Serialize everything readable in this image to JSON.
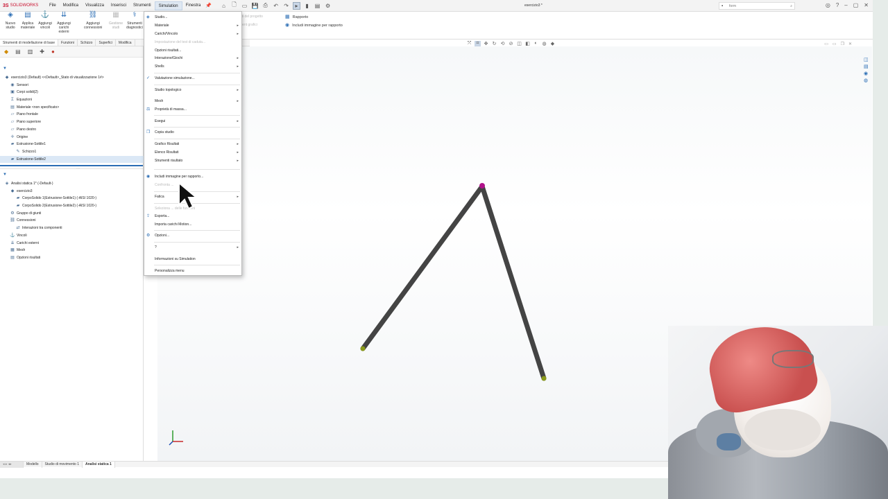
{
  "app": {
    "brand_prefix": "3S",
    "brand_name": "SOLIDWORKS",
    "document_title": "esercizio3 *",
    "search_placeholder": "form"
  },
  "menubar": [
    "File",
    "Modifica",
    "Visualizza",
    "Inserisci",
    "Strumenti",
    "Simulation",
    "Finestra"
  ],
  "commands": [
    {
      "label": "Nuovo studio",
      "icon": "study-icon"
    },
    {
      "label": "Applica materiale",
      "icon": "material-icon"
    },
    {
      "label": "Aggiungi vincoli",
      "icon": "fixture-icon"
    },
    {
      "label": "Aggiungi carichi esterni",
      "icon": "load-icon"
    },
    {
      "label": "Aggiungi connessioni",
      "icon": "connection-icon"
    },
    {
      "label": "Gestione studi",
      "icon": "manage-icon"
    },
    {
      "label": "Strumenti diagnostici",
      "icon": "diagnostic-icon"
    }
  ],
  "cmd_right": {
    "rapporto": "Rapporto",
    "include_image": "Includi immagine per rapporto",
    "ghost_1": "isti del progetto",
    "ghost_2": "ment grafici"
  },
  "tabs": [
    "Strumenti di modellazione di base",
    "Funzioni",
    "Schizzo",
    "Superfici",
    "Modifica"
  ],
  "feature_tree": [
    {
      "label": "esercizio3 (Default) <<Default>_Stato di visualizzazione 1#>",
      "icon": "part-icon",
      "level": 0
    },
    {
      "label": "Sensori",
      "icon": "sensor-icon",
      "level": 1
    },
    {
      "label": "Corpi solidi(2)",
      "icon": "solid-bodies-icon",
      "level": 1
    },
    {
      "label": "Equazioni",
      "icon": "equation-icon",
      "level": 1
    },
    {
      "label": "Materiale <non specificato>",
      "icon": "material-icon",
      "level": 1
    },
    {
      "label": "Piano frontale",
      "icon": "plane-icon",
      "level": 1
    },
    {
      "label": "Piano superiore",
      "icon": "plane-icon",
      "level": 1
    },
    {
      "label": "Piano destro",
      "icon": "plane-icon",
      "level": 1
    },
    {
      "label": "Origine",
      "icon": "origin-icon",
      "level": 1
    },
    {
      "label": "Estrusione-Sottile1",
      "icon": "extrude-icon",
      "level": 1
    },
    {
      "label": "Schizzo1",
      "icon": "sketch-icon",
      "level": 2
    },
    {
      "label": "Estrusione-Sottile2",
      "icon": "extrude-icon",
      "level": 1
    }
  ],
  "sim_tree": [
    {
      "label": "Analisi statica 1* (-Default-)",
      "icon": "analysis-icon",
      "level": 0
    },
    {
      "label": "esercizio3",
      "icon": "part-icon",
      "level": 1
    },
    {
      "label": "CorpoSolido 1(Estrusione-Sottile1) (-AISI 1020-)",
      "icon": "body-icon",
      "level": 2
    },
    {
      "label": "CorpoSolido 2(Estrusione-Sottile2) (-AISI 1020-)",
      "icon": "body-icon",
      "level": 2
    },
    {
      "label": "Gruppo di giunti",
      "icon": "joint-group-icon",
      "level": 1
    },
    {
      "label": "Connessioni",
      "icon": "connections-icon",
      "level": 1
    },
    {
      "label": "Interazioni tra componenti",
      "icon": "interaction-icon",
      "level": 2
    },
    {
      "label": "Vincoli",
      "icon": "fixture-icon",
      "level": 1
    },
    {
      "label": "Carichi esterni",
      "icon": "load-icon",
      "level": 1
    },
    {
      "label": "Mesh",
      "icon": "mesh-icon",
      "level": 1
    },
    {
      "label": "Opzioni risultati",
      "icon": "results-icon",
      "level": 1
    }
  ],
  "simulation_menu": [
    {
      "label": "Studio...",
      "icon": "study-icon",
      "arrow": false,
      "disabled": false
    },
    {
      "label": "Materiale",
      "arrow": true,
      "disabled": false
    },
    {
      "label": "Carichi/Vincolo",
      "arrow": true,
      "disabled": false
    },
    {
      "label": "Impostazione del test di caduta...",
      "arrow": false,
      "disabled": true
    },
    {
      "label": "Opzioni risultati...",
      "arrow": false,
      "disabled": false
    },
    {
      "label": "Interazione/Giochi",
      "arrow": true,
      "disabled": false
    },
    {
      "label": "Shells",
      "arrow": true,
      "disabled": false
    },
    {
      "label": "Valutazione simulazione...",
      "icon": "evaluate-icon",
      "arrow": false,
      "disabled": false
    },
    {
      "label": "Studio topologico",
      "arrow": true,
      "disabled": false
    },
    {
      "label": "Mesh",
      "arrow": true,
      "disabled": false
    },
    {
      "label": "Proprietà di massa...",
      "icon": "mass-icon",
      "arrow": false,
      "disabled": false
    },
    {
      "label": "Esegui",
      "arrow": true,
      "disabled": false
    },
    {
      "label": "Copia studio",
      "icon": "copy-icon",
      "arrow": false,
      "disabled": false
    },
    {
      "label": "Grafico Risultati",
      "arrow": true,
      "disabled": false
    },
    {
      "label": "Elenco Risultati",
      "arrow": true,
      "disabled": false
    },
    {
      "label": "Strumenti risultato",
      "arrow": true,
      "disabled": false
    },
    {
      "label": "Includi immagine per rapporto...",
      "icon": "image-icon",
      "arrow": false,
      "disabled": false
    },
    {
      "label": "Confronta ...",
      "arrow": false,
      "disabled": true
    },
    {
      "label": "Fatica",
      "arrow": true,
      "disabled": false
    },
    {
      "label": "Seleziona ... delle funzioni",
      "arrow": false,
      "disabled": true
    },
    {
      "label": "Esporta...",
      "icon": "export-icon",
      "arrow": false,
      "disabled": false
    },
    {
      "label": "Importa carichi Motion...",
      "arrow": false,
      "disabled": false
    },
    {
      "label": "Opzioni...",
      "icon": "options-icon",
      "arrow": false,
      "disabled": false
    },
    {
      "label": "?",
      "arrow": true,
      "disabled": false
    },
    {
      "label": "Informazioni su Simulation",
      "arrow": false,
      "disabled": false
    },
    {
      "label": "Personalizza menu",
      "arrow": false,
      "disabled": false
    }
  ],
  "bottom_tabs": [
    "Modello",
    "Studio di movimento 1",
    "Analisi statica 1"
  ],
  "colors": {
    "accent": "#2a6db4",
    "beam": "#4a4a4a",
    "apex_point": "#b0128a",
    "end_point": "#8a9a1a"
  }
}
